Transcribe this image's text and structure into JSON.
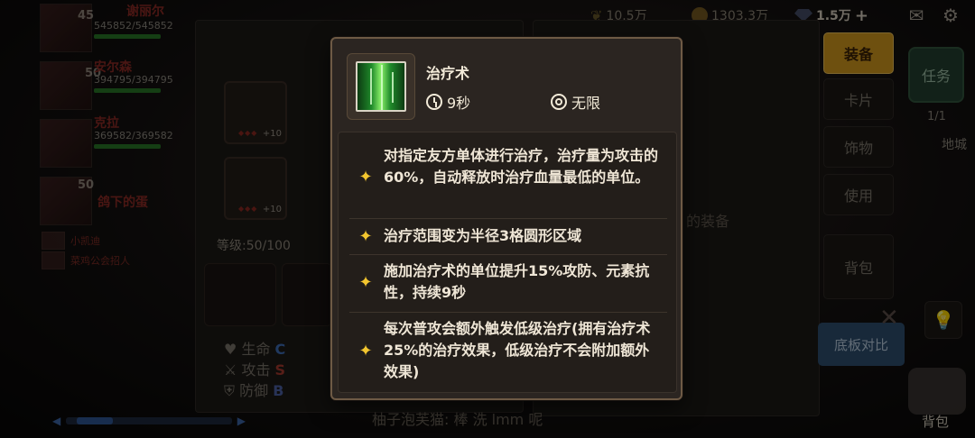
{
  "topbar": {
    "wheat_value": "10.5万",
    "coin_value": "1303.3万",
    "gem_value": "1.5万",
    "plus_label": "+",
    "mail_icon": "mail-icon",
    "settings_icon": "gear-icon"
  },
  "party": {
    "members": [
      {
        "name": "谢丽尔",
        "level": "45",
        "hp": "545852/545852"
      },
      {
        "name": "安尔森",
        "level": "50",
        "hp": "394795/394795"
      },
      {
        "name": "克拉",
        "level": "",
        "hp": "369582/369582"
      },
      {
        "name": "鸽下的蛋",
        "level": "50",
        "hp": ""
      }
    ],
    "small_members": [
      {
        "name": "小凯迪"
      },
      {
        "name": "菜鸡公会招人"
      }
    ]
  },
  "character": {
    "equip_levels": [
      "+10",
      "+10"
    ],
    "level_text": "等级:50/100",
    "stats": [
      {
        "label": "生命",
        "grade": "C"
      },
      {
        "label": "攻击",
        "grade": "S"
      },
      {
        "label": "防御",
        "grade": "B"
      }
    ]
  },
  "inventory": {
    "hint": "的装备",
    "tabs": [
      "装备",
      "卡片",
      "饰物",
      "使用",
      "背包"
    ],
    "compare_label": "底板对比",
    "task_label": "任务",
    "task_count": "1/1",
    "city_label": "地城",
    "bag_label": "背包",
    "chat_text": "柚子泡芙猫: 棒 洗 lmm 呢"
  },
  "tooltip": {
    "skill_name": "治疗术",
    "cooldown": "9秒",
    "range": "无限",
    "effects": [
      "对指定友方单体进行治疗，治疗量为攻击的60%，自动释放时治疗血量最低的单位。",
      "治疗范围变为半径3格圆形区域",
      "施加治疗术的单位提升15%攻防、元素抗性，持续9秒",
      "每次普攻会额外触发低级治疗(拥有治疗术25%的治疗效果，低级治疗不会附加额外效果)"
    ]
  },
  "colors": {
    "accent_gold": "#d49a1e",
    "star_yellow": "#f3c62f",
    "tooltip_bg": "#2b2521",
    "tooltip_border": "#6e5a45"
  }
}
